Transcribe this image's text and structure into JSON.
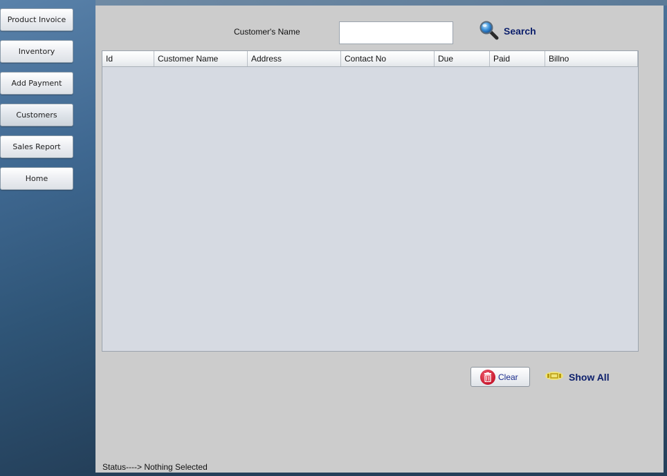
{
  "sidebar": {
    "items": [
      {
        "label": "Product Invoice"
      },
      {
        "label": "Inventory"
      },
      {
        "label": "Add Payment"
      },
      {
        "label": "Customers"
      },
      {
        "label": "Sales Report"
      },
      {
        "label": "Home"
      }
    ],
    "active": "Customers"
  },
  "search": {
    "label": "Customer's Name",
    "value": "",
    "button_label": "Search"
  },
  "table": {
    "columns": [
      "Id",
      "Customer Name",
      "Address",
      "Contact No",
      "Due",
      "Paid",
      "Billno"
    ],
    "rows": []
  },
  "actions": {
    "clear_label": "Clear",
    "show_all_label": "Show All"
  },
  "status": {
    "text": "Status----> Nothing Selected"
  },
  "colors": {
    "accent_text": "#0b1e6b",
    "panel_bg": "#cccccc",
    "table_bg": "#d6dae2"
  }
}
